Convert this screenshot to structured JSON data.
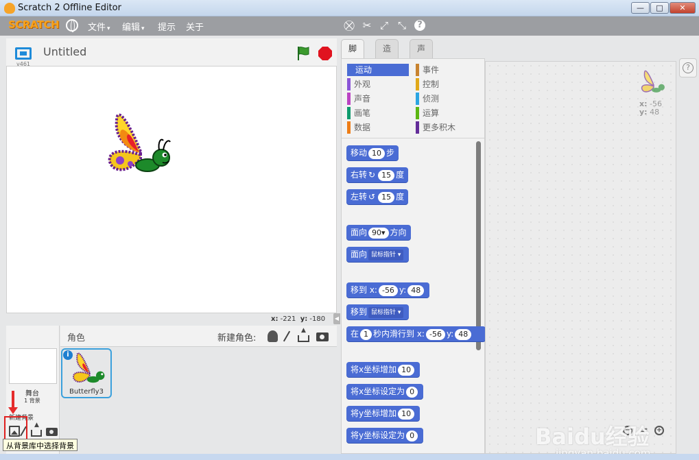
{
  "window": {
    "title": "Scratch 2 Offline Editor",
    "minimize": "—",
    "maximize": "□",
    "close": "✕"
  },
  "menubar": {
    "logo": "SCRATCH",
    "menus": [
      "文件",
      "编辑",
      "提示",
      "关于"
    ],
    "caret": "▾",
    "tool_icons": [
      "copy-stamp-icon",
      "cut-scissors-icon",
      "grow-icon",
      "shrink-icon",
      "help-icon"
    ],
    "help_glyph": "?"
  },
  "stage": {
    "version": "v461",
    "project_title": "Untitled",
    "coords": {
      "x_label": "x:",
      "x_value": "-221",
      "y_label": "y:",
      "y_value": "-180"
    },
    "collapse_glyph": "◀"
  },
  "sprites": {
    "title": "角色",
    "new_sprite_label": "新建角色:",
    "stage_label": "舞台",
    "backdrop_count": "1 背景",
    "new_backdrop_label": "新建背景",
    "tooltip": "从背景库中选择背景",
    "items": [
      {
        "name": "Butterfly3",
        "info": "i"
      }
    ]
  },
  "tabs": [
    "脚本",
    "造型",
    "声音"
  ],
  "categories": {
    "left": [
      {
        "label": "运动",
        "color": "#4a6cd4"
      },
      {
        "label": "外观",
        "color": "#8a55d7"
      },
      {
        "label": "声音",
        "color": "#bb42c3"
      },
      {
        "label": "画笔",
        "color": "#0e9a6c"
      },
      {
        "label": "数据",
        "color": "#ee7d16"
      }
    ],
    "right": [
      {
        "label": "事件",
        "color": "#c88330"
      },
      {
        "label": "控制",
        "color": "#e1a91a"
      },
      {
        "label": "侦测",
        "color": "#2ca5e2"
      },
      {
        "label": "运算",
        "color": "#5cb712"
      },
      {
        "label": "更多积木",
        "color": "#632d99"
      }
    ]
  },
  "blocks": {
    "move": {
      "a": "移动",
      "v": "10",
      "b": "步"
    },
    "turn_right": {
      "a": "右转",
      "glyph": "↻",
      "v": "15",
      "b": "度"
    },
    "turn_left": {
      "a": "左转",
      "glyph": "↺",
      "v": "15",
      "b": "度"
    },
    "point_dir": {
      "a": "面向",
      "v": "90▾",
      "b": "方向"
    },
    "point_towards": {
      "a": "面向",
      "d": "鼠标指针 ▾"
    },
    "goto_xy": {
      "a": "移到 x:",
      "x": "-56",
      "yl": "y:",
      "y": "48"
    },
    "goto": {
      "a": "移到",
      "d": "鼠标指针 ▾"
    },
    "glide": {
      "a": "在",
      "secs": "1",
      "b": "秒内滑行到 x:",
      "x": "-56",
      "yl": "y:",
      "y": "48"
    },
    "change_x": {
      "a": "将x坐标增加",
      "v": "10"
    },
    "set_x": {
      "a": "将x坐标设定为",
      "v": "0"
    },
    "change_y": {
      "a": "将y坐标增加",
      "v": "10"
    },
    "set_y": {
      "a": "将y坐标设定为",
      "v": "0"
    }
  },
  "scripts_area": {
    "x_label": "x:",
    "x_value": "-56",
    "y_label": "y:",
    "y_value": "48",
    "zoom_out": "−",
    "zoom_reset": "=",
    "zoom_in": "+",
    "help": "?"
  },
  "watermark": {
    "brand": "Baidu经验",
    "url": "jingyan.baidu.com"
  }
}
